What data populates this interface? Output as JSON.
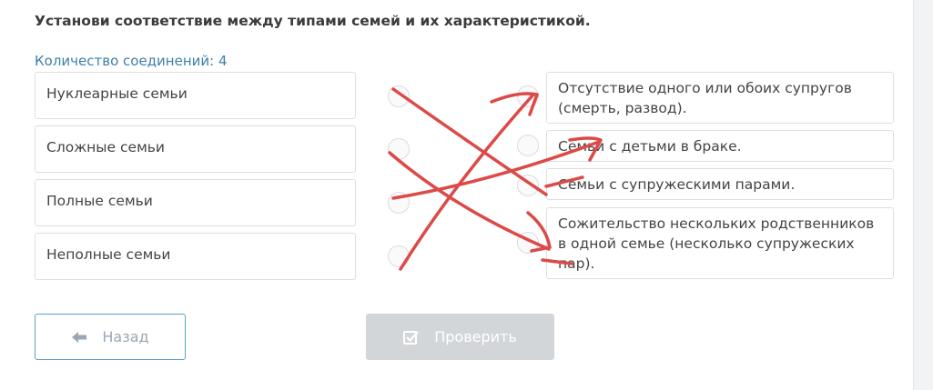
{
  "task": {
    "title": "Установи соответствие между типами семей и их характеристикой.",
    "count_label": "Количество соединений: 4"
  },
  "left_items": [
    {
      "label": "Нуклеарные семьи"
    },
    {
      "label": "Сложные семьи"
    },
    {
      "label": "Полные семьи"
    },
    {
      "label": "Неполные семьи"
    }
  ],
  "right_items": [
    {
      "label": "Отсутствие одного или обоих супругов (смерть, развод)."
    },
    {
      "label": "Семьи с детьми в браке."
    },
    {
      "label": "Семьи с супружескими парами."
    },
    {
      "label": "Сожительство нескольких родственников в одной семье (несколько супружеских пар)."
    }
  ],
  "buttons": {
    "back_label": "Назад",
    "check_label": "Проверить"
  },
  "icons": {
    "back": "arrow-left-icon",
    "check": "checkbox-check-icon"
  },
  "colors": {
    "annotation_stroke": "#dc4a48",
    "link_text": "#3e7fa8",
    "back_border": "#5aa0c9",
    "check_disabled_bg": "#d3d6d9"
  }
}
